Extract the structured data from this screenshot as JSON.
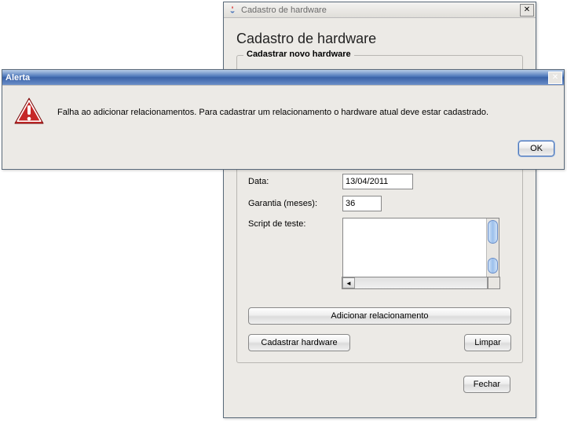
{
  "main_window": {
    "title": "Cadastro de hardware",
    "page_title": "Cadastro de hardware",
    "group_title": "Cadastrar novo hardware",
    "fields": {
      "data_label": "Data:",
      "data_value": "13/04/2011",
      "garantia_label": "Garantia (meses):",
      "garantia_value": "36",
      "script_label": "Script de teste:",
      "script_value": ""
    },
    "buttons": {
      "add_rel": "Adicionar relacionamento",
      "cadastrar": "Cadastrar hardware",
      "limpar": "Limpar",
      "fechar": "Fechar"
    }
  },
  "alert": {
    "title": "Alerta",
    "message": "Falha ao adicionar relacionamentos. Para cadastrar um relacionamento o hardware atual deve estar cadastrado.",
    "ok": "OK"
  },
  "icons": {
    "close": "✕",
    "java": "☕",
    "left": "◄",
    "right": "►"
  }
}
